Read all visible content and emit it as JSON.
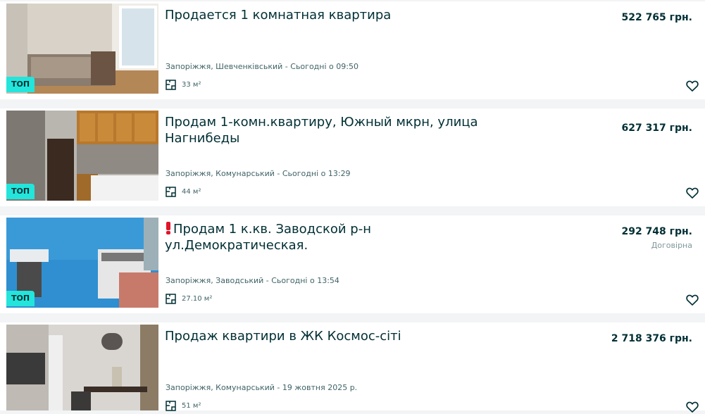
{
  "listings": [
    {
      "badge": "ТОП",
      "title": "Продается 1 комнатная квартира",
      "price": "522 765 грн.",
      "negotiable": "",
      "location": "Запоріжжя, Шевченківський - Сьогодні о 09:50",
      "area": "33 м²"
    },
    {
      "badge": "ТОП",
      "title": "Продам 1-комн.квартиру, Южный мкрн, улица Нагнибеды",
      "price": "627 317 грн.",
      "negotiable": "",
      "location": "Запоріжжя, Комунарський - Сьогодні о 13:29",
      "area": "44 м²"
    },
    {
      "badge": "ТОП",
      "title": "Продам 1 к.кв. Заводской р-н ул.Демократическая.",
      "price": "292 748 грн.",
      "negotiable": "Договірна",
      "location": "Запоріжжя, Заводський - Сьогодні о 13:54",
      "area": "27.10 м²"
    },
    {
      "badge": "",
      "title": "Продаж квартири в ЖК Космос-сіті",
      "price": "2 718 376 грн.",
      "negotiable": "",
      "location": "Запоріжжя, Комунарський - 19 жовтня 2025 р.",
      "area": "51 м²"
    }
  ],
  "icons": {
    "area": "floor-plan-icon",
    "favorite": "heart-outline-icon",
    "alert": "red-exclamation-icon"
  },
  "colors": {
    "badge_bg": "#23e5db",
    "text_primary": "#002f34",
    "text_secondary": "#406367"
  }
}
